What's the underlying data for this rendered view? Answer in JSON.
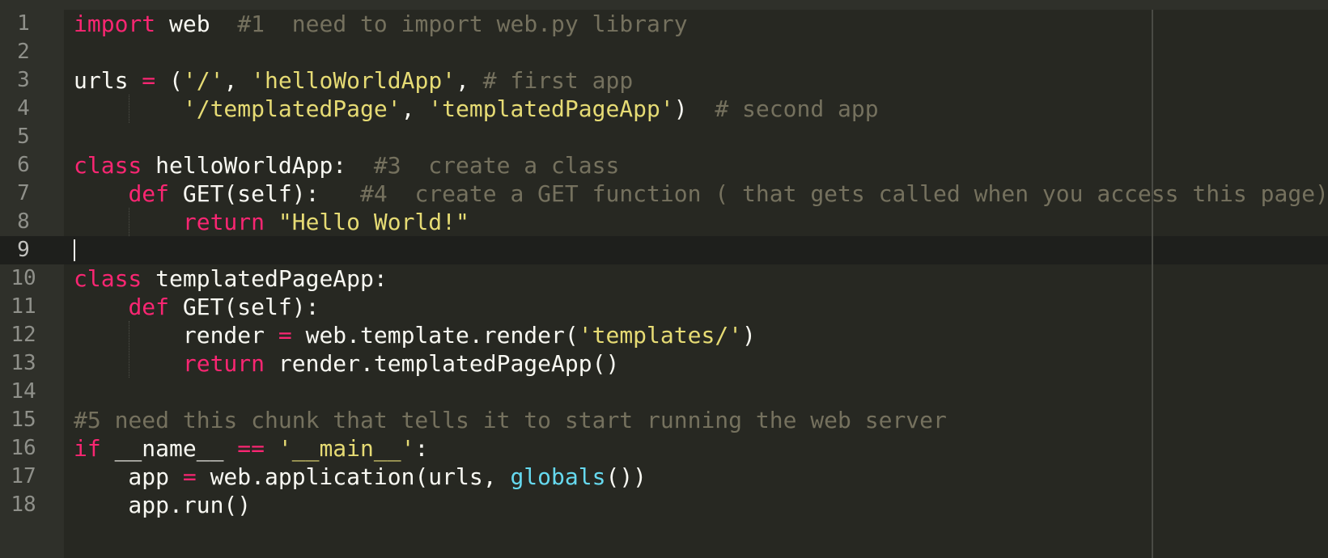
{
  "editor": {
    "line_numbers": [
      "1",
      "2",
      "3",
      "4",
      "5",
      "6",
      "7",
      "8",
      "9",
      "10",
      "11",
      "12",
      "13",
      "14",
      "15",
      "16",
      "17",
      "18"
    ],
    "current_line": "9",
    "lines": [
      {
        "t": [
          {
            "k": "kw",
            "v": "import"
          },
          {
            "k": "plain",
            "v": " web  "
          },
          {
            "k": "cm",
            "v": "#1  need to import web.py library"
          }
        ]
      },
      {
        "t": []
      },
      {
        "t": [
          {
            "k": "plain",
            "v": "urls "
          },
          {
            "k": "op",
            "v": "="
          },
          {
            "k": "plain",
            "v": " ("
          },
          {
            "k": "str",
            "v": "'/'"
          },
          {
            "k": "plain",
            "v": ", "
          },
          {
            "k": "str",
            "v": "'helloWorldApp'"
          },
          {
            "k": "plain",
            "v": ", "
          },
          {
            "k": "cm",
            "v": "# first app"
          }
        ]
      },
      {
        "t": [
          {
            "k": "plain",
            "v": "        "
          },
          {
            "k": "str",
            "v": "'/templatedPage'"
          },
          {
            "k": "plain",
            "v": ", "
          },
          {
            "k": "str",
            "v": "'templatedPageApp'"
          },
          {
            "k": "plain",
            "v": ")  "
          },
          {
            "k": "cm",
            "v": "# second app"
          }
        ]
      },
      {
        "t": []
      },
      {
        "t": [
          {
            "k": "kw",
            "v": "class"
          },
          {
            "k": "plain",
            "v": " helloWorldApp:  "
          },
          {
            "k": "cm",
            "v": "#3  create a class"
          }
        ]
      },
      {
        "t": [
          {
            "k": "plain",
            "v": "    "
          },
          {
            "k": "kw",
            "v": "def"
          },
          {
            "k": "plain",
            "v": " GET(self):   "
          },
          {
            "k": "cm",
            "v": "#4  create a GET function ( that gets called when you access this page)"
          }
        ]
      },
      {
        "t": [
          {
            "k": "plain",
            "v": "        "
          },
          {
            "k": "kw",
            "v": "return"
          },
          {
            "k": "plain",
            "v": " "
          },
          {
            "k": "str",
            "v": "\"Hello World!\""
          }
        ]
      },
      {
        "t": []
      },
      {
        "t": [
          {
            "k": "kw",
            "v": "class"
          },
          {
            "k": "plain",
            "v": " templatedPageApp:"
          }
        ]
      },
      {
        "t": [
          {
            "k": "plain",
            "v": "    "
          },
          {
            "k": "kw",
            "v": "def"
          },
          {
            "k": "plain",
            "v": " GET(self):"
          }
        ]
      },
      {
        "t": [
          {
            "k": "plain",
            "v": "        render "
          },
          {
            "k": "op",
            "v": "="
          },
          {
            "k": "plain",
            "v": " web.template.render("
          },
          {
            "k": "str",
            "v": "'templates/'"
          },
          {
            "k": "plain",
            "v": ")"
          }
        ]
      },
      {
        "t": [
          {
            "k": "plain",
            "v": "        "
          },
          {
            "k": "kw",
            "v": "return"
          },
          {
            "k": "plain",
            "v": " render.templatedPageApp()"
          }
        ]
      },
      {
        "t": []
      },
      {
        "t": [
          {
            "k": "cm",
            "v": "#5 need this chunk that tells it to start running the web server"
          }
        ]
      },
      {
        "t": [
          {
            "k": "kw",
            "v": "if"
          },
          {
            "k": "plain",
            "v": " __name__ "
          },
          {
            "k": "op",
            "v": "=="
          },
          {
            "k": "plain",
            "v": " "
          },
          {
            "k": "str",
            "v": "'__main__'"
          },
          {
            "k": "plain",
            "v": ":"
          }
        ]
      },
      {
        "t": [
          {
            "k": "plain",
            "v": "    app "
          },
          {
            "k": "op",
            "v": "="
          },
          {
            "k": "plain",
            "v": " web.application(urls, "
          },
          {
            "k": "bi",
            "v": "globals"
          },
          {
            "k": "plain",
            "v": "())"
          }
        ]
      },
      {
        "t": [
          {
            "k": "plain",
            "v": "    app.run()"
          }
        ]
      }
    ]
  },
  "colors": {
    "background": "#272822",
    "gutter": "#2f302a",
    "keyword": "#f92672",
    "string": "#e6db74",
    "comment": "#75715e",
    "builtin": "#66d9ef",
    "text": "#f8f8f2"
  }
}
